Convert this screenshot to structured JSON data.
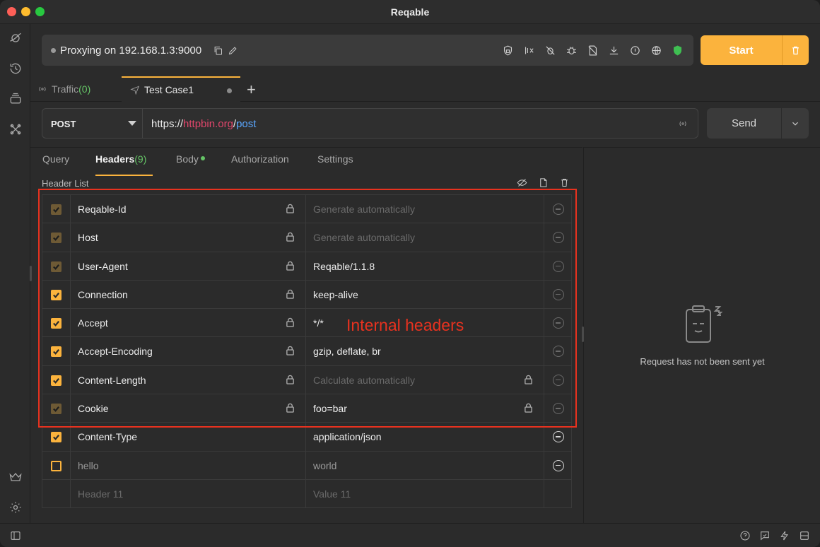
{
  "app": {
    "title": "Reqable"
  },
  "rail": {
    "icons": [
      "planet-icon",
      "history-icon",
      "layers-icon",
      "tools-icon",
      "crown-icon",
      "gear-icon",
      "sidebar-toggle-icon"
    ]
  },
  "proxy": {
    "status_text": "Proxying on 192.168.1.3:9000",
    "toolbar_icons": [
      "ssl-lock-icon",
      "filter-mute-icon",
      "no-bug-icon",
      "bug-icon",
      "no-file-icon",
      "download-icon",
      "throttle-icon",
      "globe-icon",
      "shield-icon"
    ],
    "start_label": "Start",
    "accent": "#fbb33d"
  },
  "tabs": {
    "traffic_label": "Traffic",
    "traffic_count": "(0)",
    "testcase_label": "Test Case1"
  },
  "request": {
    "method": "POST",
    "url_scheme": "https://",
    "url_host": "httpbin.org",
    "url_sep": "/",
    "url_path": "post",
    "send_label": "Send"
  },
  "subtabs": {
    "query": "Query",
    "headers": "Headers",
    "headers_count": "(9)",
    "body": "Body",
    "authorization": "Authorization",
    "settings": "Settings"
  },
  "header_list": {
    "label": "Header List",
    "rows": [
      {
        "name": "Reqable-Id",
        "value": "Generate automatically",
        "checked": "dim",
        "locked_name": true,
        "locked_value": false,
        "value_placeholder": true
      },
      {
        "name": "Host",
        "value": "Generate automatically",
        "checked": "dim",
        "locked_name": true,
        "locked_value": false,
        "value_placeholder": true
      },
      {
        "name": "User-Agent",
        "value": "Reqable/1.1.8",
        "checked": "dim",
        "locked_name": true,
        "locked_value": false,
        "value_placeholder": false
      },
      {
        "name": "Connection",
        "value": "keep-alive",
        "checked": "on",
        "locked_name": true,
        "locked_value": false,
        "value_placeholder": false
      },
      {
        "name": "Accept",
        "value": "*/*",
        "checked": "on",
        "locked_name": true,
        "locked_value": false,
        "value_placeholder": false
      },
      {
        "name": "Accept-Encoding",
        "value": "gzip, deflate, br",
        "checked": "on",
        "locked_name": true,
        "locked_value": false,
        "value_placeholder": false
      },
      {
        "name": "Content-Length",
        "value": "Calculate automatically",
        "checked": "on",
        "locked_name": true,
        "locked_value": true,
        "value_placeholder": true
      },
      {
        "name": "Cookie",
        "value": "foo=bar",
        "checked": "dim",
        "locked_name": true,
        "locked_value": true,
        "value_placeholder": false
      },
      {
        "name": "Content-Type",
        "value": "application/json",
        "checked": "on",
        "locked_name": false,
        "locked_value": false,
        "value_placeholder": false
      },
      {
        "name": "hello",
        "value": "world",
        "checked": "off",
        "locked_name": false,
        "locked_value": false,
        "value_placeholder": false
      }
    ],
    "new_row": {
      "name_placeholder": "Header 11",
      "value_placeholder": "Value 11"
    }
  },
  "annotation": {
    "text": "Internal headers",
    "color": "#e8321f"
  },
  "response": {
    "empty_text": "Request has not been sent yet"
  }
}
